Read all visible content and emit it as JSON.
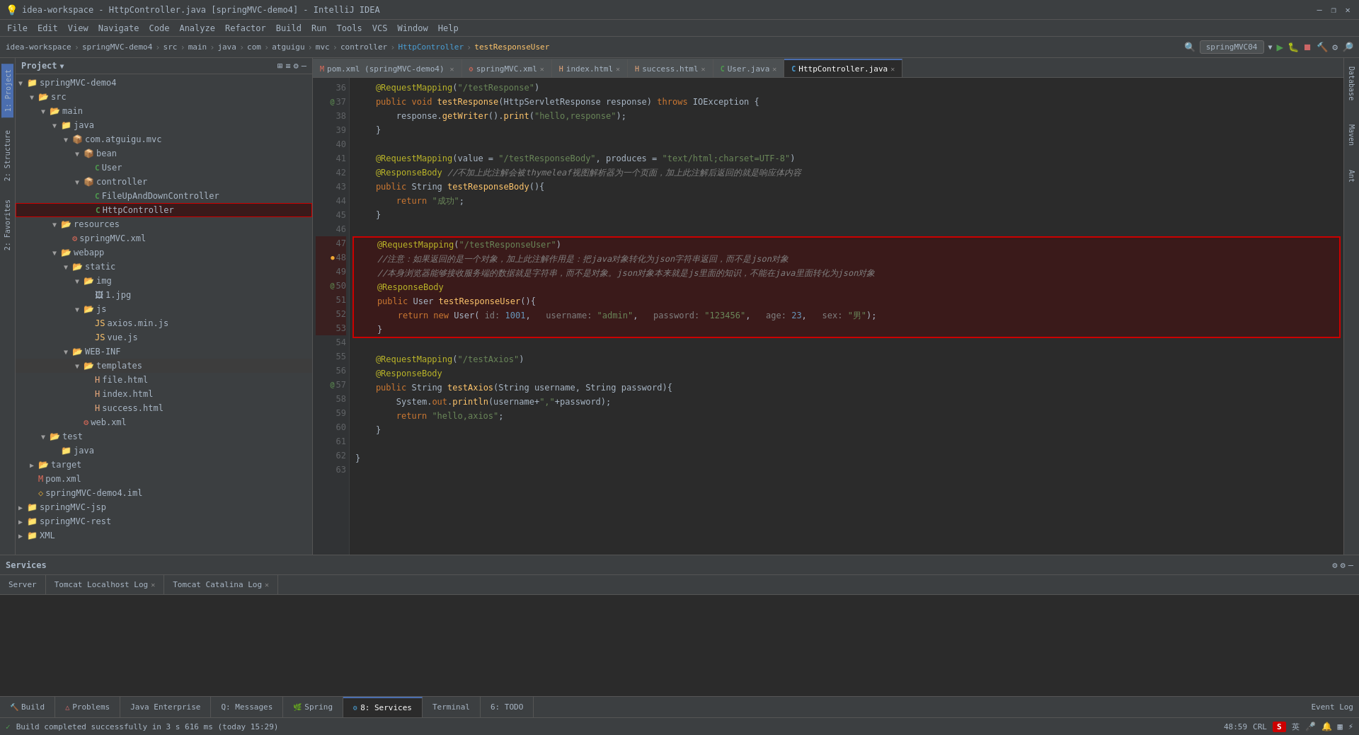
{
  "app": {
    "title": "idea-workspace - HttpController.java [springMVC-demo4] - IntelliJ IDEA",
    "icon": "💡"
  },
  "titlebar": {
    "title": "idea-workspace - HttpController.java [springMVC-demo4] - IntelliJ IDEA",
    "minimize": "—",
    "maximize": "❐",
    "close": "✕"
  },
  "menubar": {
    "items": [
      "File",
      "Edit",
      "View",
      "Navigate",
      "Code",
      "Analyze",
      "Refactor",
      "Build",
      "Run",
      "Tools",
      "VCS",
      "Window",
      "Help"
    ]
  },
  "navbar": {
    "items": [
      "idea-workspace",
      "springMVC-demo4",
      "src",
      "main",
      "java",
      "com",
      "atguigu",
      "mvc",
      "controller",
      "HttpController",
      "testResponseUser"
    ]
  },
  "toolbar": {
    "run_config": "springMVC04",
    "items": [
      "▶",
      "⏹",
      "🔨",
      "⚙"
    ]
  },
  "project": {
    "title": "Project",
    "tree": [
      {
        "id": "springMVC-demo4",
        "label": "springMVC-demo4",
        "depth": 0,
        "type": "module",
        "expanded": true
      },
      {
        "id": "src",
        "label": "src",
        "depth": 1,
        "type": "folder",
        "expanded": true
      },
      {
        "id": "main",
        "label": "main",
        "depth": 2,
        "type": "folder",
        "expanded": true
      },
      {
        "id": "java",
        "label": "java",
        "depth": 3,
        "type": "folder-blue",
        "expanded": true
      },
      {
        "id": "com.atguigu.mvc",
        "label": "com.atguigu.mvc",
        "depth": 4,
        "type": "package",
        "expanded": true
      },
      {
        "id": "bean",
        "label": "bean",
        "depth": 5,
        "type": "package",
        "expanded": true
      },
      {
        "id": "User",
        "label": "User",
        "depth": 6,
        "type": "class"
      },
      {
        "id": "controller",
        "label": "controller",
        "depth": 5,
        "type": "package",
        "expanded": true
      },
      {
        "id": "FileUpAndDownController",
        "label": "FileUpAndDownController",
        "depth": 6,
        "type": "class"
      },
      {
        "id": "HttpController",
        "label": "HttpController",
        "depth": 6,
        "type": "class",
        "selected": true,
        "highlighted": true
      },
      {
        "id": "resources",
        "label": "resources",
        "depth": 3,
        "type": "folder",
        "expanded": true
      },
      {
        "id": "springMVC.xml",
        "label": "springMVC.xml",
        "depth": 4,
        "type": "xml"
      },
      {
        "id": "webapp",
        "label": "webapp",
        "depth": 3,
        "type": "folder",
        "expanded": true
      },
      {
        "id": "static",
        "label": "static",
        "depth": 4,
        "type": "folder",
        "expanded": true
      },
      {
        "id": "img",
        "label": "img",
        "depth": 5,
        "type": "folder",
        "expanded": true
      },
      {
        "id": "1.jpg",
        "label": "1.jpg",
        "depth": 6,
        "type": "image"
      },
      {
        "id": "js",
        "label": "js",
        "depth": 5,
        "type": "folder",
        "expanded": true
      },
      {
        "id": "axios.min.js",
        "label": "axios.min.js",
        "depth": 6,
        "type": "js"
      },
      {
        "id": "vue.js",
        "label": "vue.js",
        "depth": 6,
        "type": "js"
      },
      {
        "id": "WEB-INF",
        "label": "WEB-INF",
        "depth": 4,
        "type": "folder",
        "expanded": true
      },
      {
        "id": "templates",
        "label": "templates",
        "depth": 5,
        "type": "folder",
        "expanded": true
      },
      {
        "id": "file.html",
        "label": "file.html",
        "depth": 6,
        "type": "html"
      },
      {
        "id": "index.html",
        "label": "index.html",
        "depth": 6,
        "type": "html"
      },
      {
        "id": "success.html",
        "label": "success.html",
        "depth": 6,
        "type": "html"
      },
      {
        "id": "web.xml",
        "label": "web.xml",
        "depth": 5,
        "type": "xml"
      },
      {
        "id": "test",
        "label": "test",
        "depth": 2,
        "type": "folder",
        "expanded": true
      },
      {
        "id": "java2",
        "label": "java",
        "depth": 3,
        "type": "folder-yellow"
      },
      {
        "id": "target",
        "label": "target",
        "depth": 1,
        "type": "folder",
        "expanded": true
      },
      {
        "id": "pom.xml",
        "label": "pom.xml",
        "depth": 2,
        "type": "xml"
      },
      {
        "id": "springMVC-demo4.iml",
        "label": "springMVC-demo4.iml",
        "depth": 2,
        "type": "iml"
      },
      {
        "id": "springMVC-jsp",
        "label": "springMVC-jsp",
        "depth": 0,
        "type": "module"
      },
      {
        "id": "springMVC-rest",
        "label": "springMVC-rest",
        "depth": 0,
        "type": "module"
      },
      {
        "id": "XML",
        "label": "XML",
        "depth": 0,
        "type": "module"
      }
    ]
  },
  "editor": {
    "tabs": [
      {
        "id": "pom.xml",
        "label": "pom.xml",
        "subtitle": "springMVC-demo4",
        "active": false,
        "modified": false
      },
      {
        "id": "springMVC.xml",
        "label": "springMVC.xml",
        "active": false,
        "modified": false
      },
      {
        "id": "index.html",
        "label": "index.html",
        "active": false,
        "modified": false
      },
      {
        "id": "success.html",
        "label": "success.html",
        "active": false,
        "modified": false
      },
      {
        "id": "User.java",
        "label": "User.java",
        "active": false,
        "modified": false
      },
      {
        "id": "HttpController.java",
        "label": "HttpController.java",
        "active": true,
        "modified": false
      }
    ],
    "lines": [
      {
        "num": 36,
        "content": "    @RequestMapping(\"/testResponse\")",
        "type": "annotation"
      },
      {
        "num": 37,
        "content": "    public void testResponse(HttpServletResponse response) throws IOException {",
        "type": "code"
      },
      {
        "num": 38,
        "content": "        response.getWriter().print(\"hello,response\");",
        "type": "code"
      },
      {
        "num": 39,
        "content": "    }",
        "type": "code"
      },
      {
        "num": 40,
        "content": "",
        "type": "empty"
      },
      {
        "num": 41,
        "content": "    @RequestMapping(value = \"/testResponseBody\", produces = \"text/html;charset=UTF-8\")",
        "type": "annotation"
      },
      {
        "num": 42,
        "content": "    @ResponseBody //不加上此注解会被thymeleaf视图解析器为一个页面，加上此注解后返回的就是响应体内容",
        "type": "annotation-comment"
      },
      {
        "num": 43,
        "content": "    public String testResponseBody(){",
        "type": "code"
      },
      {
        "num": 44,
        "content": "        return \"成功\";",
        "type": "code"
      },
      {
        "num": 45,
        "content": "    }",
        "type": "code"
      },
      {
        "num": 46,
        "content": "",
        "type": "empty"
      },
      {
        "num": 47,
        "content": "    @RequestMapping(\"/testResponseUser\")",
        "type": "annotation-highlight"
      },
      {
        "num": 48,
        "content": "    //注意：如果返回的是一个对象，加上此注解作用是：把java对象转化为json字符串返回，而不是json对象",
        "type": "comment-highlight"
      },
      {
        "num": 49,
        "content": "    //本身浏览器能够接收服务端的数据就是字符串，而不是对象。json对象本来就是js里面的知识，不能在java里面转化为json对象",
        "type": "comment-highlight"
      },
      {
        "num": 50,
        "content": "    @ResponseBody",
        "type": "annotation-highlight"
      },
      {
        "num": 51,
        "content": "    public User testResponseUser(){",
        "type": "code-highlight"
      },
      {
        "num": 52,
        "content": "        return new User( id: 1001,   username: \"admin\",   password: \"123456\",   age: 23,   sex: \"男\");",
        "type": "code-highlight"
      },
      {
        "num": 53,
        "content": "    }",
        "type": "code-highlight"
      },
      {
        "num": 54,
        "content": "",
        "type": "empty"
      },
      {
        "num": 55,
        "content": "    @RequestMapping(\"/testAxios\")",
        "type": "annotation"
      },
      {
        "num": 56,
        "content": "    @ResponseBody",
        "type": "annotation"
      },
      {
        "num": 57,
        "content": "    public String testAxios(String username, String password){",
        "type": "code"
      },
      {
        "num": 58,
        "content": "        System.out.println(username+\",\"+password);",
        "type": "code"
      },
      {
        "num": 59,
        "content": "        return \"hello,axios\";",
        "type": "code"
      },
      {
        "num": 60,
        "content": "    }",
        "type": "code"
      },
      {
        "num": 61,
        "content": "",
        "type": "empty"
      },
      {
        "num": 62,
        "content": "}",
        "type": "code"
      },
      {
        "num": 63,
        "content": "",
        "type": "empty"
      }
    ]
  },
  "bottom": {
    "tabs": [
      "Build",
      "Problems",
      "Java Enterprise",
      "Q: Messages",
      "Spring",
      "8: Services",
      "Terminal",
      "6: TODO"
    ],
    "active_tab": "8: Services",
    "services_label": "Services",
    "server_tab": "Server",
    "tomcat_localhost_tab": "Tomcat Localhost Log",
    "tomcat_catalina_tab": "Tomcat Catalina Log"
  },
  "statusbar": {
    "build_status": "Build completed successfully in 3 s 616 ms (today 15:29)",
    "position": "48:59",
    "encoding": "CRL",
    "lang": "英",
    "event_log": "Event Log"
  },
  "side_tabs": {
    "left": [
      "1: Project",
      "2: Favorites"
    ],
    "right": [
      "Database",
      "Maven",
      "Ant"
    ]
  }
}
